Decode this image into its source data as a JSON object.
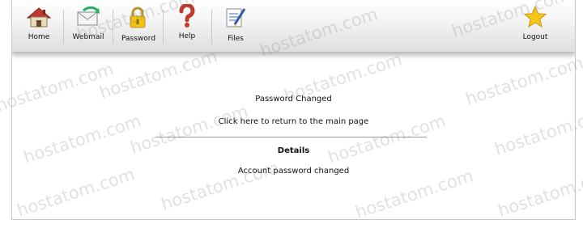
{
  "toolbar": {
    "items": [
      {
        "label": "Home",
        "icon": "home-icon"
      },
      {
        "label": "Webmail",
        "icon": "webmail-icon"
      },
      {
        "label": "Password",
        "icon": "padlock-icon"
      },
      {
        "label": "Help",
        "icon": "question-icon"
      },
      {
        "label": "Files",
        "icon": "files-icon"
      },
      {
        "label": "Logout",
        "icon": "star-icon"
      }
    ]
  },
  "main": {
    "status": "Password Changed",
    "return_link": "Click here to return to the main page",
    "details_heading": "Details",
    "details_text": "Account password changed"
  },
  "watermark": {
    "text": "hostatom.com"
  },
  "colors": {
    "toolbar_bg": "#e6e6e6",
    "rule": "#9a9a9a"
  }
}
